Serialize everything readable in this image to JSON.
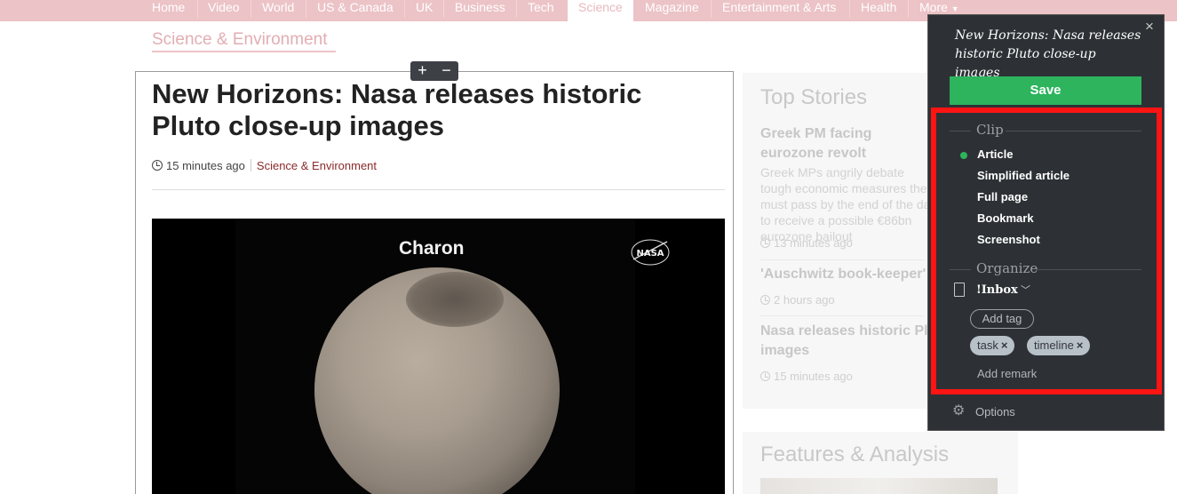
{
  "nav": {
    "items": [
      "Home",
      "Video",
      "World",
      "US & Canada",
      "UK",
      "Business",
      "Tech",
      "Science",
      "Magazine",
      "Entertainment & Arts",
      "Health",
      "More"
    ],
    "active": "Science"
  },
  "section": {
    "title": "Science & Environment"
  },
  "article": {
    "headline": "New Horizons: Nasa releases historic Pluto close-up images",
    "time": "15 minutes ago",
    "category": "Science & Environment",
    "image_caption": "Charon",
    "image_logo": "NASA"
  },
  "zoom": {
    "plus": "+",
    "minus": "−"
  },
  "sidebar": {
    "top_stories_heading": "Top Stories",
    "stories": [
      {
        "title": "Greek PM facing eurozone revolt",
        "summary": "Greek MPs angrily debate tough economic measures they must pass by the end of the day to receive a possible €86bn eurozone bailout",
        "time": "13 minutes ago"
      },
      {
        "title": "'Auschwitz book-keeper'",
        "time": "2 hours ago"
      },
      {
        "title": "Nasa releases historic Pl images",
        "time": "15 minutes ago"
      }
    ],
    "features_heading": "Features & Analysis"
  },
  "clipper": {
    "close_icon": "×",
    "title": "New Horizons: Nasa releases historic Pluto close-up images",
    "save_label": "Save",
    "clip_label": "Clip",
    "clip_options": [
      "Article",
      "Simplified article",
      "Full page",
      "Bookmark",
      "Screenshot"
    ],
    "selected_option": "Article",
    "organize_label": "Organize",
    "notebook": "!Inbox",
    "add_tag_label": "Add tag",
    "tags": [
      "task",
      "timeline"
    ],
    "add_remark_label": "Add remark",
    "options_label": "Options",
    "accent_color": "#2db45d",
    "highlight_color": "#ff1414"
  }
}
